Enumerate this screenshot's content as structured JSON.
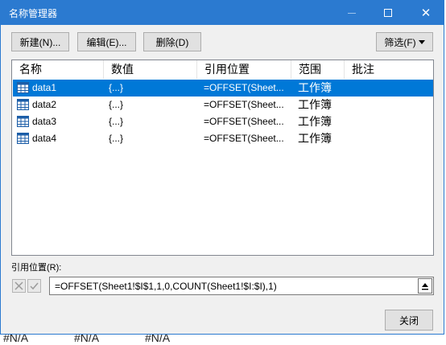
{
  "window": {
    "title": "名称管理器"
  },
  "toolbar": {
    "new_label": "新建(N)...",
    "edit_label": "编辑(E)...",
    "delete_label": "删除(D)",
    "filter_label": "筛选(F)"
  },
  "list": {
    "columns": [
      "名称",
      "数值",
      "引用位置",
      "范围",
      "批注"
    ],
    "rows": [
      {
        "name": "data1",
        "value": "{...}",
        "ref": "=OFFSET(Sheet...",
        "scope": "工作簿",
        "comment": ""
      },
      {
        "name": "data2",
        "value": "{...}",
        "ref": "=OFFSET(Sheet...",
        "scope": "工作簿",
        "comment": ""
      },
      {
        "name": "data3",
        "value": "{...}",
        "ref": "=OFFSET(Sheet...",
        "scope": "工作簿",
        "comment": ""
      },
      {
        "name": "data4",
        "value": "{...}",
        "ref": "=OFFSET(Sheet...",
        "scope": "工作簿",
        "comment": ""
      }
    ],
    "selected_index": 0
  },
  "refers_to": {
    "label": "引用位置(R):",
    "value": "=OFFSET(Sheet1!$I$1,1,0,COUNT(Sheet1!$I:$I),1)"
  },
  "footer": {
    "close_label": "关闭"
  },
  "background": {
    "cells": [
      "#N/A",
      "#N/A",
      "#N/A"
    ]
  },
  "colors": {
    "titlebar": "#2b7ad0",
    "selection": "#0078d7"
  },
  "icons": [
    "minimize-icon",
    "maximize-icon",
    "close-icon",
    "table-icon",
    "cancel-x-icon",
    "confirm-check-icon",
    "collapse-dialog-icon",
    "dropdown-caret-icon"
  ]
}
